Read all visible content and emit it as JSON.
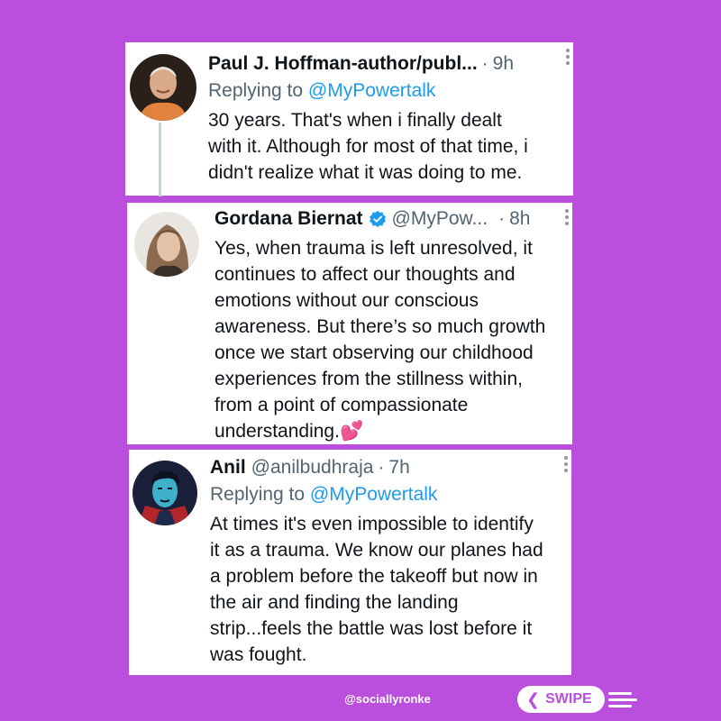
{
  "tweets": [
    {
      "author": "Paul J. Hoffman-author/publ...",
      "handle": "",
      "time": "9h",
      "reply_prefix": "Replying to ",
      "reply_to": "@MyPowertalk",
      "body_lines": [
        "30 years. That's when i finally dealt",
        "with it. Although for most of that time, i",
        "didn't realize what it was doing to me."
      ]
    },
    {
      "author": "Gordana Biernat",
      "handle": "@MyPow...",
      "time": "8h",
      "verified": true,
      "body_lines": [
        "Yes, when trauma is left unresolved, it",
        "continues to affect our thoughts and",
        "emotions without our conscious",
        "awareness. But there’s so much growth",
        "once we start observing our childhood",
        "experiences from the stillness within,",
        "from a point of compassionate",
        "understanding.💕"
      ]
    },
    {
      "author": "Anil",
      "handle": "@anilbudhraja",
      "time": "7h",
      "reply_prefix": "Replying to ",
      "reply_to": "@MyPowertalk",
      "body_lines": [
        "At times it's even impossible to identify",
        "it as a trauma. We know our planes had",
        "a problem before the takeoff but now in",
        "the air and finding the landing",
        "strip...feels the battle was lost before it",
        "was fought."
      ]
    }
  ],
  "footer": {
    "handle": "@sociallyronke",
    "swipe_label": "SWIPE"
  },
  "colors": {
    "background": "#b94fdc",
    "mention": "#1d9bf0",
    "verified": "#1d9bf0"
  }
}
